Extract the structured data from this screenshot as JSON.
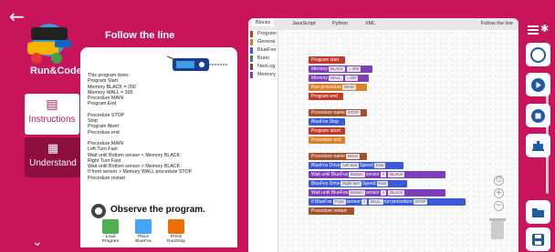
{
  "app": {
    "back_glyph": "←",
    "logo_text": "Run&Code",
    "panel_title": "Follow the line"
  },
  "nav": [
    {
      "label": "Instructions",
      "icon": "document-icon",
      "glyph": "▤",
      "active": true
    },
    {
      "label": "Understand",
      "icon": "book-icon",
      "glyph": "▦",
      "active": false
    }
  ],
  "instructions": {
    "lines": [
      "This program does:",
      "Program Start",
      "Memory BLACK = 200",
      "Memory WALL = 300",
      "Procedure MAIN",
      "Program End",
      "",
      "Procedure STOP",
      "Stop",
      "Program Abort",
      "Procedure end",
      "",
      "Procedure MAIN",
      "Left Turn Fast",
      "Wait until Bottom sensor < Memory BLACK",
      "Right Turn Fast",
      "Wait until Bottom sensor > Memory BLACK",
      "If front sensor > Memory WALL procedure STOP",
      "Procedure restart"
    ],
    "observe": "Observe the program.",
    "steps": [
      {
        "label1": "Load",
        "label2": "Program",
        "color": "#4caf50"
      },
      {
        "label1": "Place",
        "label2": "BlueFox",
        "color": "#42a5f5"
      },
      {
        "label1": "Press",
        "label2": "Run/Stop",
        "color": "#ef6c00"
      }
    ]
  },
  "workspace": {
    "tabs": [
      "Blocks",
      "JavaScript",
      "Python",
      "XML"
    ],
    "active_tab": "Blocks",
    "title": "Follow the line",
    "categories": [
      {
        "label": "Program",
        "color": "#c0392b"
      },
      {
        "label": "General",
        "color": "#d9822b"
      },
      {
        "label": "BlueFox",
        "color": "#3b5bd6"
      },
      {
        "label": "Brain",
        "color": "#2e8b57"
      },
      {
        "label": "NeoLog",
        "color": "#8b4513"
      },
      {
        "label": "Memory",
        "color": "#7b3fb8"
      }
    ],
    "blocks": {
      "b1": "Program start",
      "b2a": "Memory",
      "b2b": "BLACK",
      "b2c": "= 200",
      "b3a": "Memory",
      "b3b": "WALL",
      "b3c": "= 300",
      "b4a": "Run procedure",
      "b4b": "MAIN",
      "b5": "Program end",
      "b6a": "Procedure name",
      "b6b": "STOP",
      "b7": "BlueFox Stop",
      "b8": "Program abort",
      "b9": "Procedure end",
      "b10a": "Procedure name",
      "b10b": "MAIN",
      "b11a": "BlueFox Drive",
      "b11b": "Left turn",
      "b11c": "Speed",
      "b11d": "Fast",
      "b12a": "Wait until BlueFox",
      "b12b": "Bottom",
      "b12c": "sensor",
      "b12d": "<",
      "b12e": "BLACK",
      "b13a": "BlueFox Drive",
      "b13b": "Right turn",
      "b13c": "Speed",
      "b13d": "Fast",
      "b14a": "Wait until BlueFox",
      "b14b": "Bottom",
      "b14c": "sensor",
      "b14d": ">",
      "b14e": "BLACK",
      "b15a": "If BlueFox",
      "b15b": "Front",
      "b15c": "sensor",
      "b15d": ">",
      "b15e": "WALL",
      "b15f": "run procedure",
      "b15g": "STOP",
      "b16": "Procedure restart"
    },
    "zoom_in": "+",
    "zoom_out": "−"
  },
  "right_bar": {
    "bluetooth_glyph": "✱",
    "buttons": [
      "connect-icon",
      "play-icon",
      "stop-icon",
      "robot-icon",
      "folder-icon",
      "save-icon"
    ]
  }
}
